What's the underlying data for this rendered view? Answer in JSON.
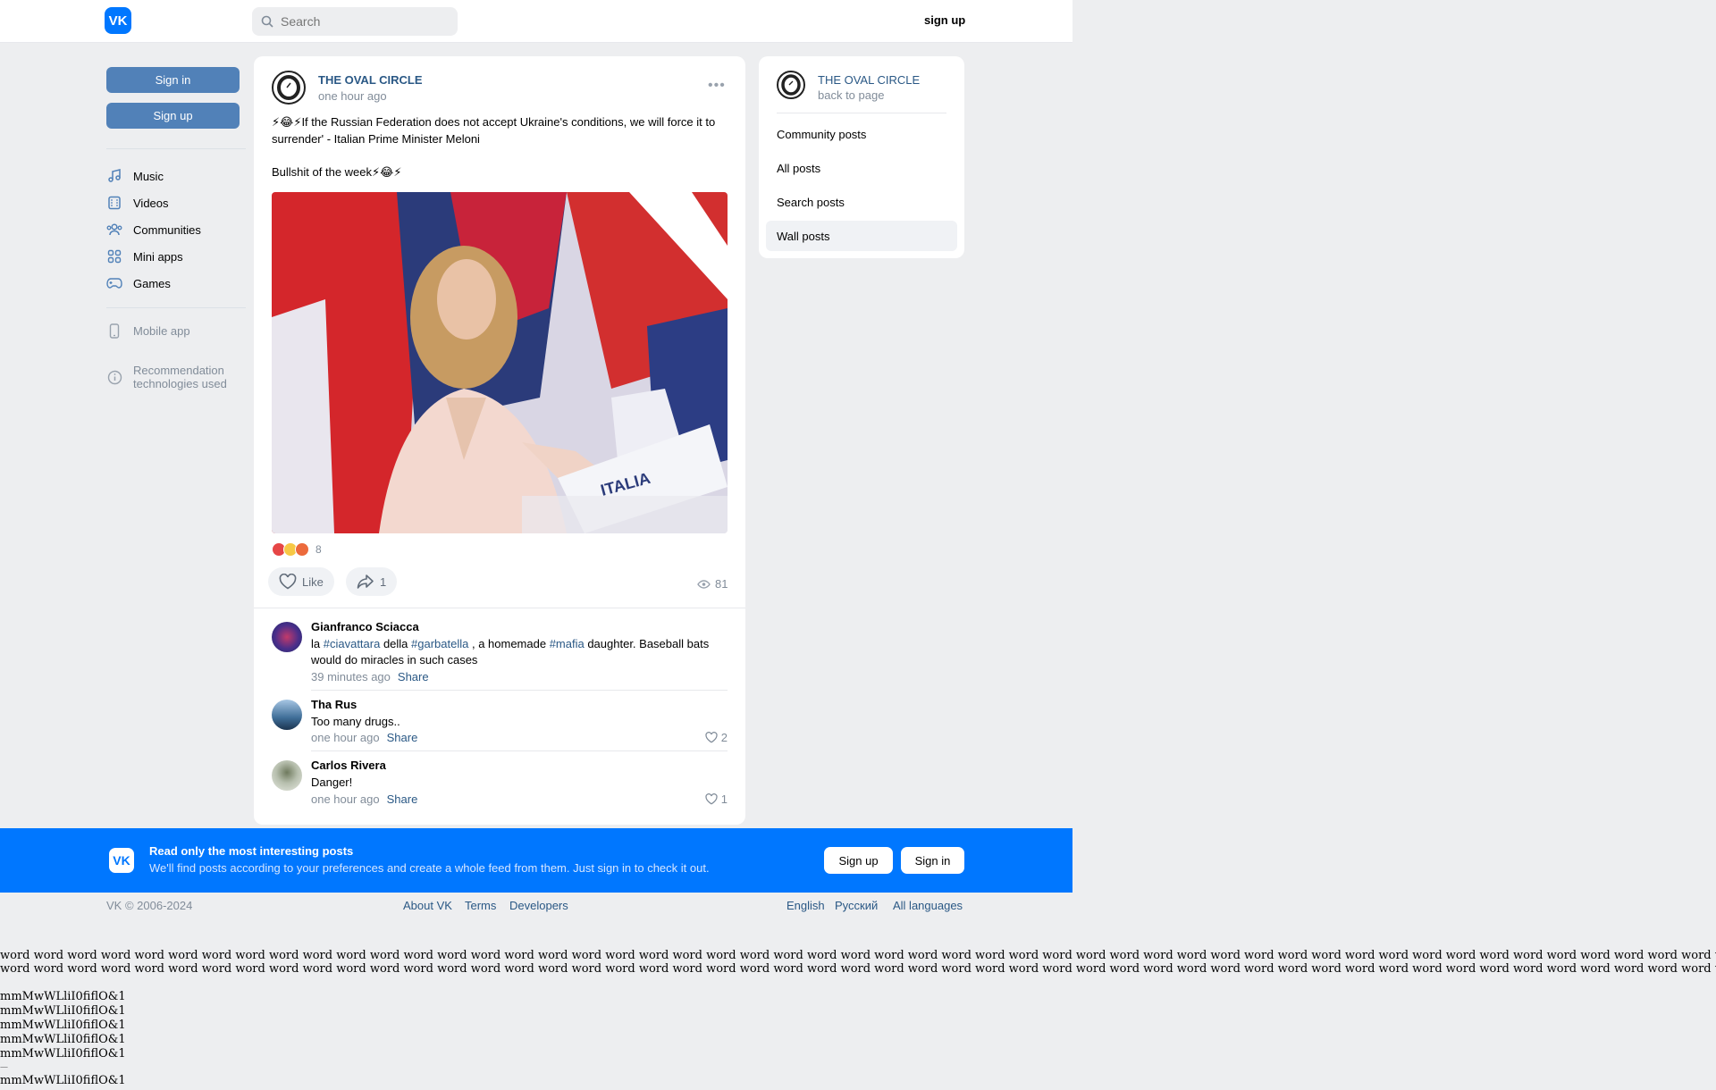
{
  "header": {
    "logo": "VK",
    "search_placeholder": "Search",
    "signup": "sign up"
  },
  "sidebar": {
    "sign_in": "Sign in",
    "sign_up": "Sign up",
    "items": [
      {
        "label": "Music",
        "icon": "music-icon"
      },
      {
        "label": "Videos",
        "icon": "video-icon"
      },
      {
        "label": "Communities",
        "icon": "communities-icon"
      },
      {
        "label": "Mini apps",
        "icon": "mini-apps-icon"
      },
      {
        "label": "Games",
        "icon": "gamepad-icon"
      }
    ],
    "mobile_app": "Mobile app",
    "recommendation": "Recommendation technologies used"
  },
  "post": {
    "author": "THE OVAL CIRCLE",
    "time": "one hour ago",
    "text1": "⚡😂⚡If the Russian Federation does not accept Ukraine's conditions, we will force it to surrender' - Italian Prime Minister Meloni",
    "text2": "Bullshit of the week⚡😂⚡",
    "reaction_count": "8",
    "like_label": "Like",
    "share_count": "1",
    "views": "81",
    "image_text": "ITALIA"
  },
  "comments": [
    {
      "name": "Gianfranco Sciacca",
      "text_a": "la ",
      "tag1": "#ciavattara",
      "text_b": " della ",
      "tag2": "#garbatella",
      "text_c": " , a homemade ",
      "tag3": "#mafia",
      "text_d": " daughter. Baseball bats would do miracles in such cases",
      "time": "39 minutes ago",
      "share": "Share"
    },
    {
      "name": "Tha Rus",
      "text": "Too many drugs..",
      "time": "one hour ago",
      "share": "Share",
      "likes": "2"
    },
    {
      "name": "Carlos Rivera",
      "text": "Danger!",
      "time": "one hour ago",
      "share": "Share",
      "likes": "1"
    }
  ],
  "right_menu": {
    "title": "THE OVAL CIRCLE",
    "back": "back to page",
    "items": [
      "Community posts",
      "All posts",
      "Search posts",
      "Wall posts"
    ]
  },
  "banner": {
    "logo": "VK",
    "title": "Read only the most interesting posts",
    "subtitle": "We'll find posts according to your preferences and create a whole feed from them. Just sign in to check it out.",
    "sign_up": "Sign up",
    "sign_in": "Sign in"
  },
  "footer": {
    "copyright": "VK © 2006-2024",
    "about": "About VK",
    "terms": "Terms",
    "developers": "Developers",
    "english": "English",
    "russian": "Русский",
    "all_languages": "All languages"
  },
  "debug": {
    "word_line": "word word word word word word word word word word word word word word word word word word word word word word word word word word word word word word word word word word word word word word word word word word word word word word word word word word word word word word word word word word word word word",
    "mm_line": "mmMwWLliI0fiflO&1",
    "dash": "—"
  }
}
